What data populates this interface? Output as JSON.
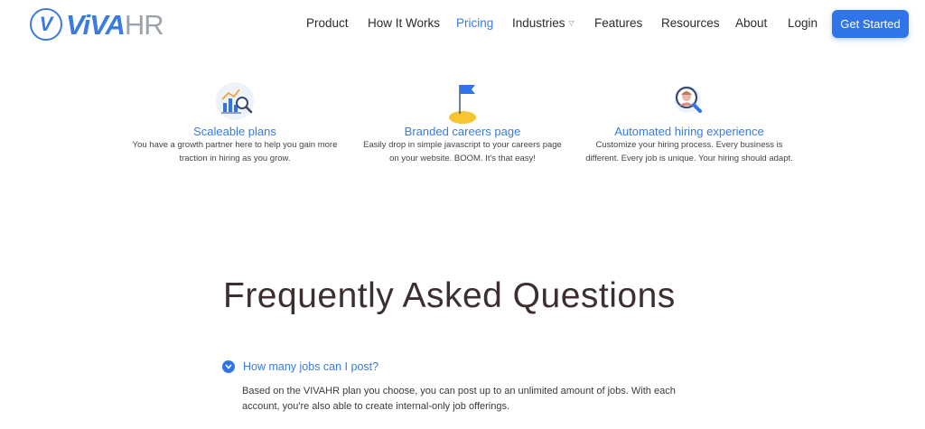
{
  "brand": {
    "logo_letter": "V",
    "logo_main": "ViVA",
    "logo_suffix": "HR",
    "accent": "#3a7be0",
    "cta_color": "#2f74e8"
  },
  "nav": {
    "items": [
      {
        "label": "Product"
      },
      {
        "label": "How It Works"
      },
      {
        "label": "Pricing",
        "active": true
      },
      {
        "label": "Industries",
        "has_dropdown": true
      },
      {
        "label": "Features"
      },
      {
        "label": "Resources"
      },
      {
        "label": "About"
      },
      {
        "label": "Login"
      }
    ],
    "cta": "Get Started"
  },
  "features": [
    {
      "icon": "chart-magnifier-icon",
      "title": "Scaleable plans",
      "desc": "You have a growth partner here to help you gain more traction in hiring as you grow."
    },
    {
      "icon": "flag-hill-icon",
      "title": "Branded careers page",
      "desc": "Easily drop in simple javascript to your careers page on your website. BOOM. It's that easy!"
    },
    {
      "icon": "person-magnifier-icon",
      "title": "Automated hiring experience",
      "desc": "Customize your hiring process. Every business is different. Every job is unique. Your hiring should adapt."
    }
  ],
  "faq": {
    "title": "Frequently Asked Questions",
    "items": [
      {
        "question": "How many jobs can I post?",
        "answer": "Based on the VIVAHR plan you choose, you can post up to an unlimited amount of jobs. With each account, you're also able to create internal-only job offerings."
      }
    ]
  }
}
